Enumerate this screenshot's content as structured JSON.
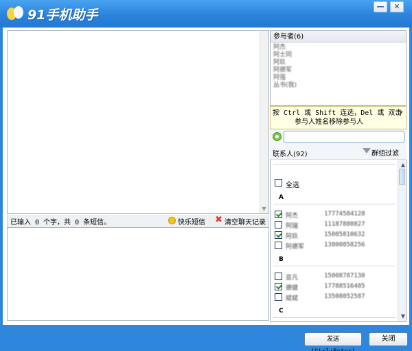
{
  "app": {
    "title": "91手机助手"
  },
  "window_controls": {
    "minimize": "—",
    "close": "✕"
  },
  "input_status": {
    "text": "已输入 0 个字，共 0 条短信。",
    "quick_sms": "快乐短信",
    "clear_history": "清空聊天记录"
  },
  "participants": {
    "header": "参与者(6)",
    "items": [
      "阿杰",
      "阿士同",
      "阿玖",
      "阿德军",
      "阿强",
      "丛书(我)"
    ]
  },
  "tip": {
    "line1": "按 Ctrl 或 Shift 连选，Del 或 双击",
    "line2": "参与人姓名移除参与人",
    "close": "×"
  },
  "search": {
    "placeholder": ""
  },
  "contacts": {
    "title": "联系人(92)",
    "filter_label": "群组过滤",
    "select_all": "全选",
    "groups": [
      {
        "letter": "A",
        "rows": [
          {
            "name": "阿杰",
            "phone": "17774584128",
            "checked": true
          },
          {
            "name": "阿瑞",
            "phone": "11187880827",
            "checked": false
          },
          {
            "name": "阿玖",
            "phone": "15005810632",
            "checked": true
          },
          {
            "name": "阿德军",
            "phone": "13800858256",
            "checked": false
          }
        ]
      },
      {
        "letter": "B",
        "rows": [
          {
            "name": "亘凡",
            "phone": "15008787130",
            "checked": false
          },
          {
            "name": "德健",
            "phone": "17788516485",
            "checked": true
          },
          {
            "name": "斌斌",
            "phone": "13508052587",
            "checked": false
          }
        ]
      },
      {
        "letter": "C",
        "rows": []
      }
    ]
  },
  "buttons": {
    "send": "发送(Ctrl+Enter)",
    "close": "关闭"
  }
}
